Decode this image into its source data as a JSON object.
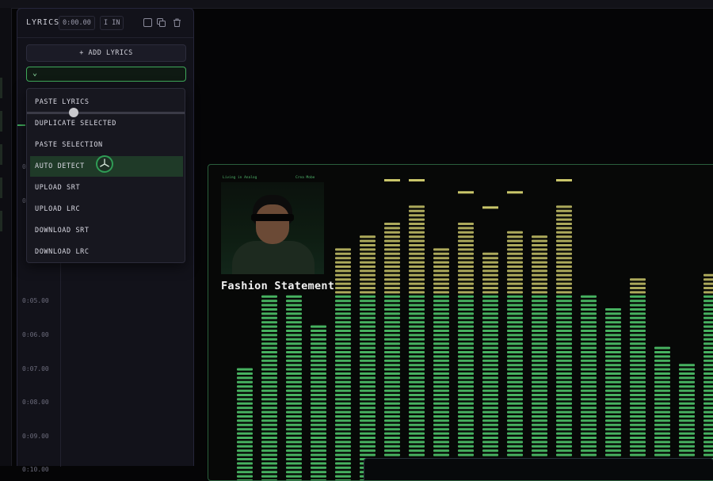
{
  "panel": {
    "title": "LYRICS",
    "time_chip": "0:00.00",
    "in_chip": "I IN",
    "icons": [
      "checkbox-icon",
      "copy-icon",
      "trash-icon"
    ]
  },
  "add_button": {
    "label": "+ ADD LYRICS"
  },
  "select": {
    "value": ""
  },
  "menu": {
    "items": [
      {
        "label": "PASTE LYRICS"
      },
      {
        "label": "DUPLICATE SELECTED"
      },
      {
        "label": "PASTE SELECTION"
      },
      {
        "label": "AUTO DETECT",
        "active": true
      },
      {
        "label": "UPLOAD SRT"
      },
      {
        "label": "UPLOAD LRC"
      },
      {
        "label": "DOWNLOAD SRT"
      },
      {
        "label": "DOWNLOAD LRC"
      }
    ]
  },
  "timeline": {
    "labels": [
      "0:0",
      "0:0",
      "0:05.00",
      "0:06.00",
      "0:07.00",
      "0:08.00",
      "0:09.00",
      "0:10.00"
    ]
  },
  "preview": {
    "mini_left": "Living in Analog",
    "mini_right": "Crea Mobe",
    "song_title": "Fashion Statement"
  },
  "colors": {
    "accent": "#3fa85a",
    "bar_green": "#4fc46a",
    "bar_yellow": "#c9c66a"
  },
  "visualizer": {
    "bars": [
      {
        "level": 0.38,
        "peak": 0.38
      },
      {
        "level": 0.62,
        "peak": 0.62
      },
      {
        "level": 0.62,
        "peak": 0.62
      },
      {
        "level": 0.52,
        "peak": 0.52
      },
      {
        "level": 0.78,
        "peak": 0.78
      },
      {
        "level": 0.82,
        "peak": 0.82
      },
      {
        "level": 0.87,
        "peak": 1.0
      },
      {
        "level": 0.92,
        "peak": 1.0
      },
      {
        "level": 0.78,
        "peak": 0.78
      },
      {
        "level": 0.86,
        "peak": 0.96
      },
      {
        "level": 0.76,
        "peak": 0.91
      },
      {
        "level": 0.84,
        "peak": 0.96
      },
      {
        "level": 0.82,
        "peak": 0.82
      },
      {
        "level": 0.92,
        "peak": 1.0
      },
      {
        "level": 0.62,
        "peak": 0.62
      },
      {
        "level": 0.58,
        "peak": 0.58
      },
      {
        "level": 0.68,
        "peak": 0.68
      },
      {
        "level": 0.46,
        "peak": 0.46
      },
      {
        "level": 0.4,
        "peak": 0.4
      },
      {
        "level": 0.7,
        "peak": 0.7
      },
      {
        "level": 0.66,
        "peak": 0.66
      }
    ]
  }
}
